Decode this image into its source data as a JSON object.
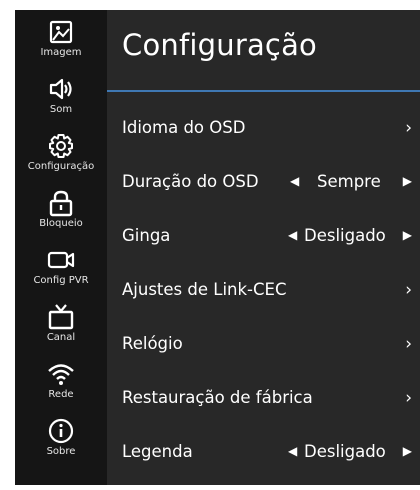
{
  "sidebar": {
    "items": [
      {
        "label": "Imagem",
        "icon": "image-icon"
      },
      {
        "label": "Som",
        "icon": "speaker-icon"
      },
      {
        "label": "Configuração",
        "icon": "gear-icon"
      },
      {
        "label": "Bloqueio",
        "icon": "lock-icon"
      },
      {
        "label": "Config PVR",
        "icon": "camera-icon"
      },
      {
        "label": "Canal",
        "icon": "tv-icon"
      },
      {
        "label": "Rede",
        "icon": "wifi-icon"
      },
      {
        "label": "Sobre",
        "icon": "info-icon"
      }
    ]
  },
  "main": {
    "title": "Configuração",
    "accent_color": "#3f78b3",
    "rows": [
      {
        "label": "Idioma do OSD",
        "type": "submenu"
      },
      {
        "label": "Duração do OSD",
        "type": "selector",
        "value": "Sempre"
      },
      {
        "label": "Ginga",
        "type": "selector",
        "value": "Desligado"
      },
      {
        "label": "Ajustes de Link-CEC",
        "type": "submenu"
      },
      {
        "label": "Relógio",
        "type": "submenu"
      },
      {
        "label": "Restauração de fábrica",
        "type": "submenu"
      },
      {
        "label": "Legenda",
        "type": "selector",
        "value": "Desligado"
      }
    ]
  },
  "glyphs": {
    "chevron": "›",
    "arrow_left": "◀",
    "arrow_right": "▶"
  }
}
